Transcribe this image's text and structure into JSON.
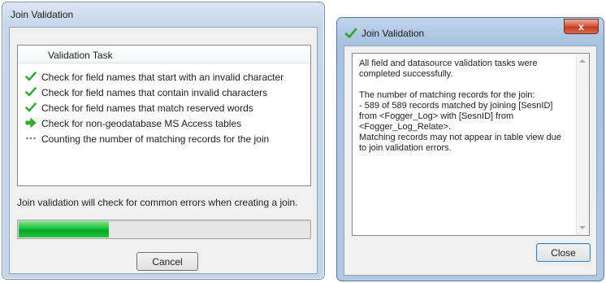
{
  "join_dialog": {
    "title": "Join Validation",
    "column_header": "Validation Task",
    "tasks": [
      {
        "label": "Check for field names that start with an invalid character",
        "status": "complete",
        "icon": "checkmark-icon"
      },
      {
        "label": "Check for field names that contain invalid characters",
        "status": "complete",
        "icon": "checkmark-icon"
      },
      {
        "label": "Check for field names that match reserved words",
        "status": "complete",
        "icon": "checkmark-icon"
      },
      {
        "label": "Check for non-geodatabase MS Access tables",
        "status": "in-progress",
        "icon": "green-arrow-icon"
      },
      {
        "label": "Counting the number of matching records for the join",
        "status": "pending",
        "icon": "ellipsis-icon"
      }
    ],
    "hint": "Join validation will check for common errors when creating a join.",
    "progress_fraction": 0.31,
    "cancel_label": "Cancel"
  },
  "result_dialog": {
    "title": "Join Validation",
    "title_icon": "checkmark-icon",
    "close_glyph": "x",
    "message": "All field and datasource validation tasks were\ncompleted successfully.\n\nThe number of matching records for the join:\n- 589 of 589 records matched by joining [SesnID]\nfrom <Fogger_Log> with [SesnID] from\n<Fogger_Log_Relate>.\nMatching records may not appear in table view due\nto join validation errors.",
    "close_label": "Close"
  },
  "colors": {
    "check_green": "#3aa53a",
    "arrow_green": "#2fb52f",
    "progress_green": "#1cc23a"
  }
}
